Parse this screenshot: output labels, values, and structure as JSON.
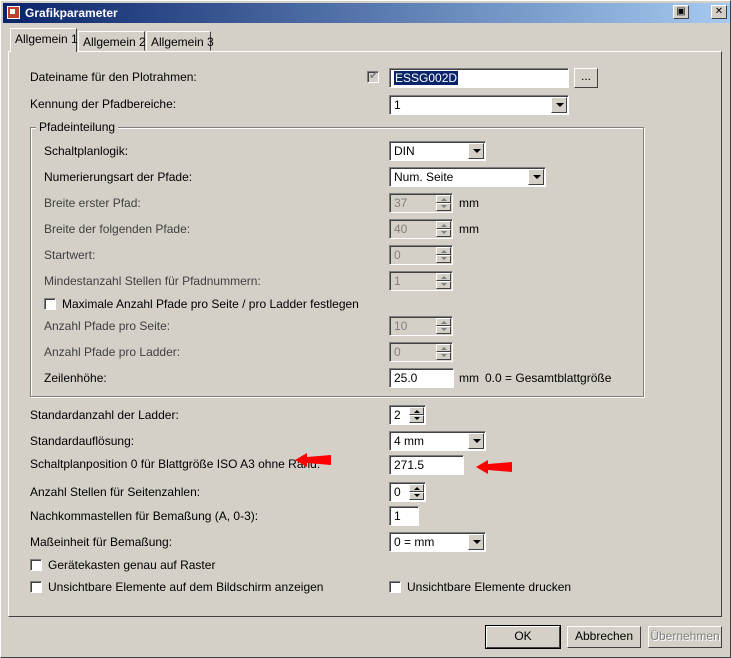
{
  "window": {
    "title": "Grafikparameter"
  },
  "tabs": [
    {
      "label": "Allgemein 1"
    },
    {
      "label": "Allgemein 2"
    },
    {
      "label": "Allgemein 3"
    }
  ],
  "fields": {
    "dateiname": {
      "label": "Dateiname für den Plotrahmen:",
      "value": "ESSG002D",
      "checked": true,
      "browse": "..."
    },
    "kennung": {
      "label": "Kennung der Pfadbereiche:",
      "value": "1"
    },
    "pfadeinteilung": {
      "group_label": "Pfadeinteilung",
      "schaltplanlogik": {
        "label": "Schaltplanlogik:",
        "value": "DIN"
      },
      "numerierungsart": {
        "label": "Numerierungsart der Pfade:",
        "value": "Num. Seite"
      },
      "breite_erster": {
        "label": "Breite erster Pfad:",
        "value": "37",
        "unit": "mm"
      },
      "breite_folgend": {
        "label": "Breite der folgenden Pfade:",
        "value": "40",
        "unit": "mm"
      },
      "startwert": {
        "label": "Startwert:",
        "value": "0"
      },
      "mindestanzahl": {
        "label": "Mindestanzahl Stellen für Pfadnummern:",
        "value": "1"
      },
      "maximale": {
        "label": "Maximale Anzahl Pfade pro Seite / pro Ladder festlegen",
        "checked": false
      },
      "pfade_seite": {
        "label": "Anzahl Pfade pro Seite:",
        "value": "10"
      },
      "pfade_ladder": {
        "label": "Anzahl Pfade pro Ladder:",
        "value": "0"
      },
      "zeilenhoehe": {
        "label": "Zeilenhöhe:",
        "value": "25.0",
        "unit": "mm",
        "hint": "0.0 = Gesamtblattgröße"
      }
    },
    "standardanzahl": {
      "label": "Standardanzahl der Ladder:",
      "value": "2"
    },
    "standardaufloesung": {
      "label": "Standardauflösung:",
      "value": "4 mm"
    },
    "schaltplanposition": {
      "label": "Schaltplanposition 0 für Blattgröße ISO A3 ohne Rand:",
      "value": "271.5"
    },
    "stellen_seitenzahlen": {
      "label": "Anzahl Stellen für Seitenzahlen:",
      "value": "0"
    },
    "nachkommastellen": {
      "label": "Nachkommastellen für Bemaßung (A, 0-3):",
      "value": "1"
    },
    "masseinheit": {
      "label": "Maßeinheit für Bemaßung:",
      "value": "0 = mm"
    },
    "geraetekasten": {
      "label": "Gerätekasten genau auf Raster",
      "checked": false
    },
    "unsichtbare_anzeigen": {
      "label": "Unsichtbare Elemente auf dem Bildschirm anzeigen",
      "checked": false
    },
    "unsichtbare_drucken": {
      "label": "Unsichtbare Elemente drucken",
      "checked": false
    }
  },
  "buttons": {
    "ok": "OK",
    "abbrechen": "Abbrechen",
    "uebernehmen": "Übernehmen"
  },
  "colors": {
    "titlebar": "#0a246a",
    "annotation_arrow": "#ff0000",
    "face": "#d4d0c8"
  }
}
